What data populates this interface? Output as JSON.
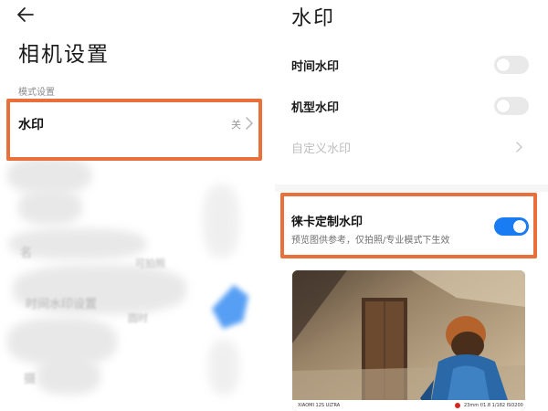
{
  "left_screen": {
    "title": "相机设置",
    "section_label": "模式设置",
    "watermark_row": {
      "label": "水印",
      "value": "关"
    },
    "blurred_fragments": [
      "名",
      "可拍照",
      "时间水印设置",
      "圆时",
      "摄"
    ]
  },
  "right_screen": {
    "title": "水印",
    "settings": [
      {
        "label": "时间水印",
        "state": "off"
      },
      {
        "label": "机型水印",
        "state": "off"
      },
      {
        "label": "自定义水印",
        "state": "disabled"
      }
    ],
    "leica": {
      "label": "徕卡定制水印",
      "description": "预览图供参考，仅拍照/专业模式下生效",
      "state": "on"
    },
    "preview_strip": {
      "device": "XIAOMI 12S ULTRA",
      "params": "23mm f/1.8 1/182 ISO200"
    }
  },
  "colors": {
    "highlight": "#e8703a",
    "toggle_on": "#1a7cf3",
    "toggle_off": "#e9e9e9"
  },
  "icons": {
    "back": "arrow-left-icon",
    "chevron": "chevron-right-icon"
  }
}
